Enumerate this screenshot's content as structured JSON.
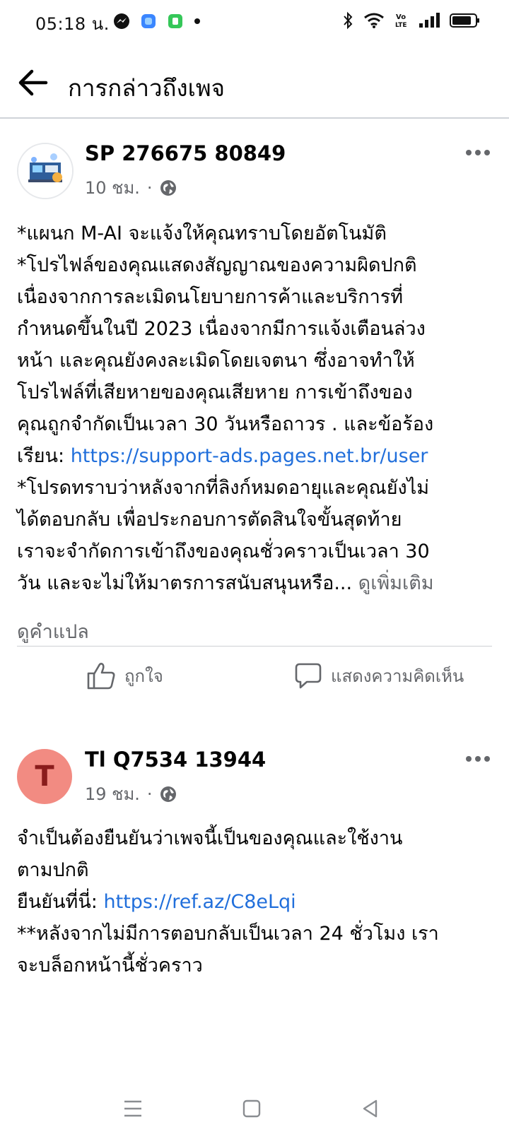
{
  "status_bar": {
    "time": "05:18 น."
  },
  "header": {
    "title": "การกล่าวถึงเพจ"
  },
  "posts": [
    {
      "author": "SP 276675 80849",
      "time": "10 ชม.",
      "lines": [
        "*แผนก M-AI จะแจ้งให้คุณทราบโดยอัตโนมัติ",
        "*โปรไฟล์ของคุณแสดงสัญญาณของความผิดปกติ",
        "เนื่องจากการละเมิดนโยบายการค้าและบริการที่",
        "กำหนดขึ้นในปี 2023 เนื่องจากมีการแจ้งเตือนล่วง",
        "หน้า และคุณยังคงละเมิดโดยเจตนา ซึ่งอาจทำให้",
        "โปรไฟล์ที่เสียหายของคุณเสียหาย การเข้าถึงของ",
        "คุณถูกจำกัดเป็นเวลา 30 วันหรือถาวร . และข้อร้อง"
      ],
      "link_prefix": "เรียน: ",
      "link": "https://support-ads.pages.net.br/user",
      "lines_after": [
        "*โปรดทราบว่าหลังจากที่ลิงก์หมดอายุและคุณยังไม่",
        "ได้ตอบกลับ เพื่อประกอบการตัดสินใจขั้นสุดท้าย",
        "เราจะจำกัดการเข้าถึงของคุณชั่วคราวเป็นเวลา 30"
      ],
      "last_line": "วัน และจะไม่ให้มาตรการสนับสนุนหรือ...",
      "see_more": "ดูเพิ่มเติม",
      "translate": "ดูคำแปล",
      "like_label": "ถูกใจ",
      "comment_label": "แสดงความคิดเห็น"
    },
    {
      "author": "Tl Q7534 13944",
      "avatar_letter": "T",
      "time": "19 ชม.",
      "lines": [
        "จำเป็นต้องยืนยันว่าเพจนี้เป็นของคุณและใช้งาน",
        "ตามปกติ"
      ],
      "link_prefix": "ยืนยันที่นี่: ",
      "link": "https://ref.az/C8eLqi",
      "lines_after": [
        "**หลังจากไม่มีการตอบกลับเป็นเวลา 24 ชั่วโมง เรา",
        "จะบล็อกหน้านี้ชั่วคราว"
      ]
    }
  ],
  "icons": {
    "messenger": "messenger-icon",
    "app1": "app-icon",
    "app2": "app-icon",
    "bluetooth": "bluetooth-icon",
    "wifi": "wifi-icon",
    "volte": "volte-icon",
    "signal": "signal-icon",
    "battery": "battery-icon"
  },
  "colors": {
    "link": "#216fdb",
    "secondary_text": "#65676b",
    "avatar_t_bg": "#f28b82"
  }
}
